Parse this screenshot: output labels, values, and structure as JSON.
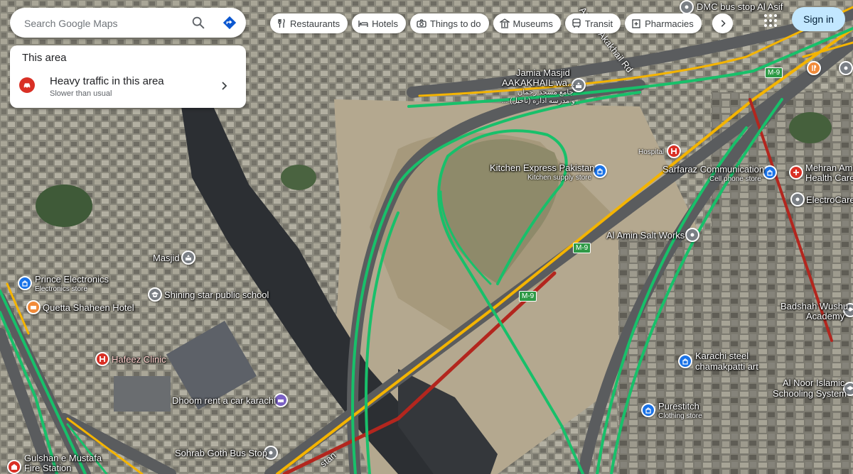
{
  "search": {
    "placeholder": "Search Google Maps"
  },
  "chips": [
    {
      "label": "Restaurants",
      "icon": "fork-knife-icon"
    },
    {
      "label": "Hotels",
      "icon": "bed-icon"
    },
    {
      "label": "Things to do",
      "icon": "camera-icon"
    },
    {
      "label": "Museums",
      "icon": "museum-icon"
    },
    {
      "label": "Transit",
      "icon": "bus-icon"
    },
    {
      "label": "Pharmacies",
      "icon": "pharmacy-icon"
    }
  ],
  "header": {
    "signin_label": "Sign in"
  },
  "area_panel": {
    "title": "This area",
    "traffic_title": "Heavy traffic in this area",
    "traffic_subtitle": "Slower than usual",
    "traffic_color": "#d93025"
  },
  "places": {
    "dmc": "DMC bus stop Al Asif",
    "jamia": "Jamia Masjid",
    "jamia2": "AAKAKHAIL wa...",
    "jamia3": "جامع مسجد رحمان",
    "jamia4": "... (ناخیل) و مدرسه اداره",
    "kitchen": "Kitchen Express Pakistan",
    "kitchen_sub": "Kitchen supply store",
    "hospital": "Hospital",
    "sarfaraz": "Sarfaraz Communication",
    "sarfaraz_sub": "Cell phone store",
    "mehran": "Mehran Amin",
    "mehran2": "Health Care",
    "electro": "ElectroCare",
    "alamin": "Al Amin Salt Works",
    "masjid": "Masjid",
    "prince": "Prince Electronics",
    "prince_sub": "Electronics store",
    "shining": "Shining star public school",
    "quetta": "Quetta Shaheen Hotel",
    "hafeez": "Hafeez Clinic",
    "dhoom": "Dhoom rent a car karachi",
    "sohrab": "Sohrab Goth Bus Stop",
    "gulshan": "Gulshan e Mustafa",
    "gulshan2": "Fire Station",
    "karachi_steel": "Karachi steel",
    "karachi_steel2": "chamakpatti art",
    "badshah": "Badshah Wushu",
    "badshah2": "Academy",
    "alnoor": "Al Noor Islamic",
    "alnoor2": "Schooling System",
    "purestitch": "Purestitch",
    "purestitch_sub": "Clothing store",
    "azeem_rd": "Azeem Akakhail Rd",
    "super_hwy": "stan"
  },
  "highway_shields": [
    "M-9",
    "M-9",
    "M-9"
  ],
  "colors": {
    "traffic_green": "#18c06a",
    "traffic_yellow": "#f4b400",
    "traffic_red": "#b3261e",
    "shop_pin": "#1a73e8",
    "hospital_pin": "#d93025",
    "hotel_pin": "#f28b3a",
    "gray_pin": "#7a7f85"
  }
}
